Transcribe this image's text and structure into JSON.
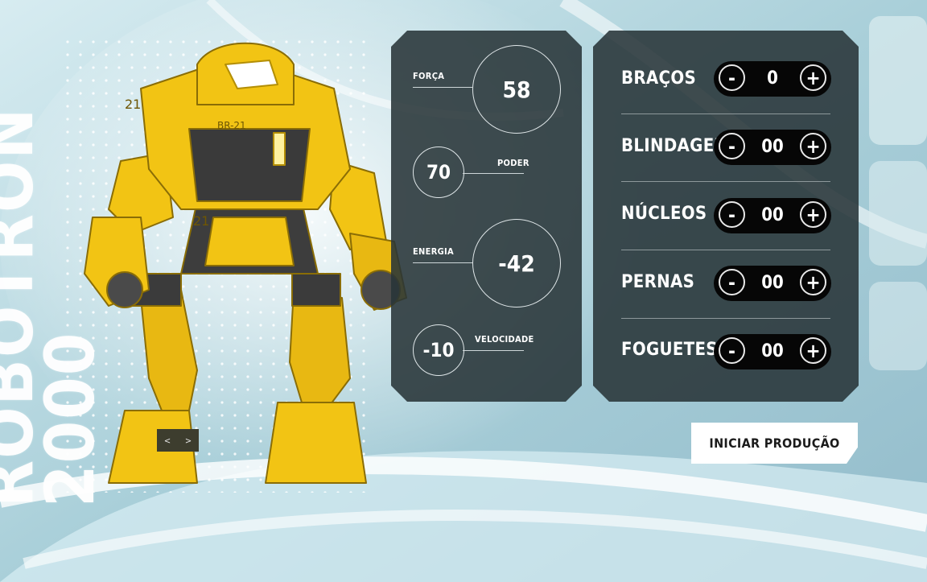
{
  "app": {
    "title_line1": "ROBOTRON",
    "title_line2": "2000"
  },
  "carousel": {
    "prev_label": "<",
    "next_label": ">"
  },
  "stats": [
    {
      "label": "FORÇA",
      "value": "58"
    },
    {
      "label": "PODER",
      "value": "70"
    },
    {
      "label": "ENERGIA",
      "value": "-42"
    },
    {
      "label": "VELOCIDADE",
      "value": "-10"
    }
  ],
  "parts": [
    {
      "name": "BRAÇOS",
      "value": "0"
    },
    {
      "name": "BLINDAGEM",
      "value": "00"
    },
    {
      "name": "NÚCLEOS",
      "value": "00"
    },
    {
      "name": "PERNAS",
      "value": "00"
    },
    {
      "name": "FOGUETES",
      "value": "00"
    }
  ],
  "stepper": {
    "minus_label": "-",
    "plus_label": "+"
  },
  "actions": {
    "start_label": "INICIAR PRODUÇÃO"
  },
  "colors": {
    "robot_yellow": "#f2c414",
    "panel": "#28343a",
    "stepper": "#060606",
    "background": "#b9d6df"
  }
}
